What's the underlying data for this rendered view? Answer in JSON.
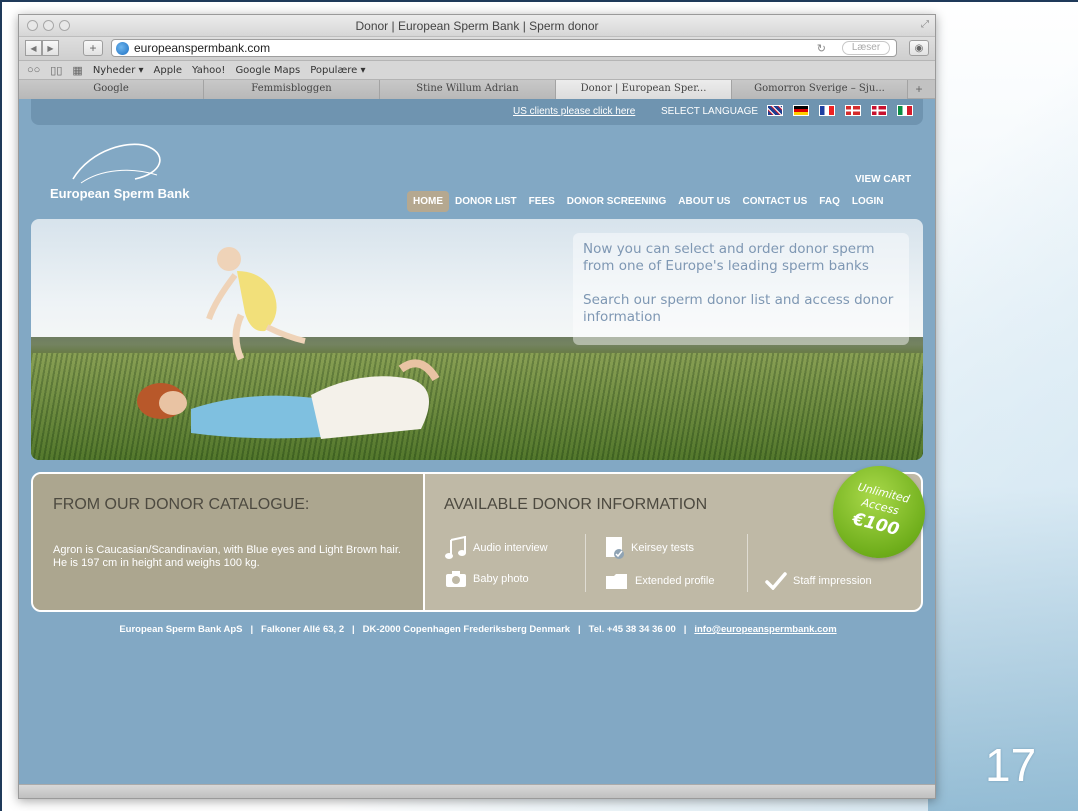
{
  "slide": {
    "number": "17"
  },
  "window": {
    "title": "Donor | European Sperm Bank | Sperm donor"
  },
  "toolbar": {
    "url": "europeanspermbank.com",
    "reader_label": "Læser"
  },
  "bookmarks": [
    "Nyheder ▾",
    "Apple",
    "Yahoo!",
    "Google Maps",
    "Populære ▾"
  ],
  "tabs": [
    {
      "label": "Google"
    },
    {
      "label": "Femmisbloggen"
    },
    {
      "label": "Stine Willum Adrian"
    },
    {
      "label": "Donor | European Sper..."
    },
    {
      "label": "Gomorron Sverige – Sju..."
    }
  ],
  "language_bar": {
    "us_link": "US clients please click here",
    "select_label": "SELECT LANGUAGE"
  },
  "brand": {
    "name": "European Sperm Bank"
  },
  "nav": {
    "view_cart": "VIEW CART",
    "items": [
      "HOME",
      "DONOR LIST",
      "FEES",
      "DONOR SCREENING",
      "ABOUT US",
      "CONTACT US",
      "FAQ",
      "LOGIN"
    ]
  },
  "hero": {
    "line1": "Now you can select and order donor sperm from one of Europe's leading sperm banks",
    "line2": "Search our sperm donor list and access donor information"
  },
  "catalogue": {
    "title": "FROM OUR DONOR CATALOGUE:",
    "description": "Agron is Caucasian/Scandinavian, with Blue eyes and Light Brown hair. He is 197 cm in height and weighs 100 kg."
  },
  "available": {
    "title": "AVAILABLE DONOR INFORMATION",
    "items": [
      "Audio interview",
      "Baby photo",
      "Keirsey tests",
      "Extended profile",
      "Staff impression"
    ]
  },
  "badge": {
    "line1": "Unlimited",
    "line2": "Access",
    "price": "€100"
  },
  "footer": {
    "company": "European Sperm Bank ApS",
    "address": "Falkoner Allé 63, 2",
    "city": "DK-2000 Copenhagen Frederiksberg Denmark",
    "phone": "Tel. +45 38 34 36 00",
    "email": "info@europeanspermbank.com"
  },
  "colors": {
    "page_bg": "#82a8c4",
    "panel": "#bfb9a6",
    "badge": "#7fbf22"
  }
}
